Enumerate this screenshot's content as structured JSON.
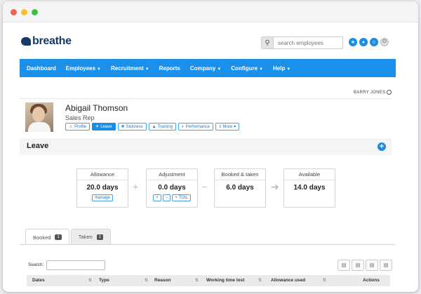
{
  "header": {
    "logo_text": "breathe",
    "search_placeholder": "search employees"
  },
  "nav": {
    "items": [
      {
        "label": "Dashboard",
        "caret": false
      },
      {
        "label": "Employees",
        "caret": true
      },
      {
        "label": "Recruitment",
        "caret": true
      },
      {
        "label": "Reports",
        "caret": false
      },
      {
        "label": "Company",
        "caret": true
      },
      {
        "label": "Configure",
        "caret": true
      },
      {
        "label": "Help",
        "caret": true
      }
    ]
  },
  "current_user": "BARRY JONES",
  "employee": {
    "name": "Abigail Thomson",
    "role": "Sales Rep",
    "tabs": [
      {
        "label": "Profile",
        "icon": "person-icon",
        "active": false
      },
      {
        "label": "Leave",
        "icon": "plane-icon",
        "active": true
      },
      {
        "label": "Sickness",
        "icon": "medkit-icon",
        "active": false
      },
      {
        "label": "Training",
        "icon": "graduation-cap-icon",
        "active": false
      },
      {
        "label": "Performance",
        "icon": "speedometer-icon",
        "active": false
      },
      {
        "label": "More",
        "icon": "list-icon",
        "active": false
      }
    ]
  },
  "leave": {
    "title": "Leave",
    "allowance": {
      "label": "Allowance",
      "value": "20.0 days",
      "action": "manage"
    },
    "adjustment": {
      "label": "Adjustment",
      "value": "0.0 days",
      "toil_label": "TOIL"
    },
    "booked_taken": {
      "label": "Booked & taken",
      "value": "6.0 days"
    },
    "available": {
      "label": "Available",
      "value": "14.0 days"
    }
  },
  "booking_tabs": [
    {
      "label": "Booked",
      "count": "1",
      "active": true
    },
    {
      "label": "Taken",
      "count": "1",
      "active": false
    }
  ],
  "table": {
    "search_label": "Search:",
    "columns": [
      "Dates",
      "Type",
      "Reason",
      "Working time lost",
      "Allowance used",
      "Actions"
    ]
  },
  "colors": {
    "accent": "#1a8ce4",
    "brand": "#163a68"
  }
}
